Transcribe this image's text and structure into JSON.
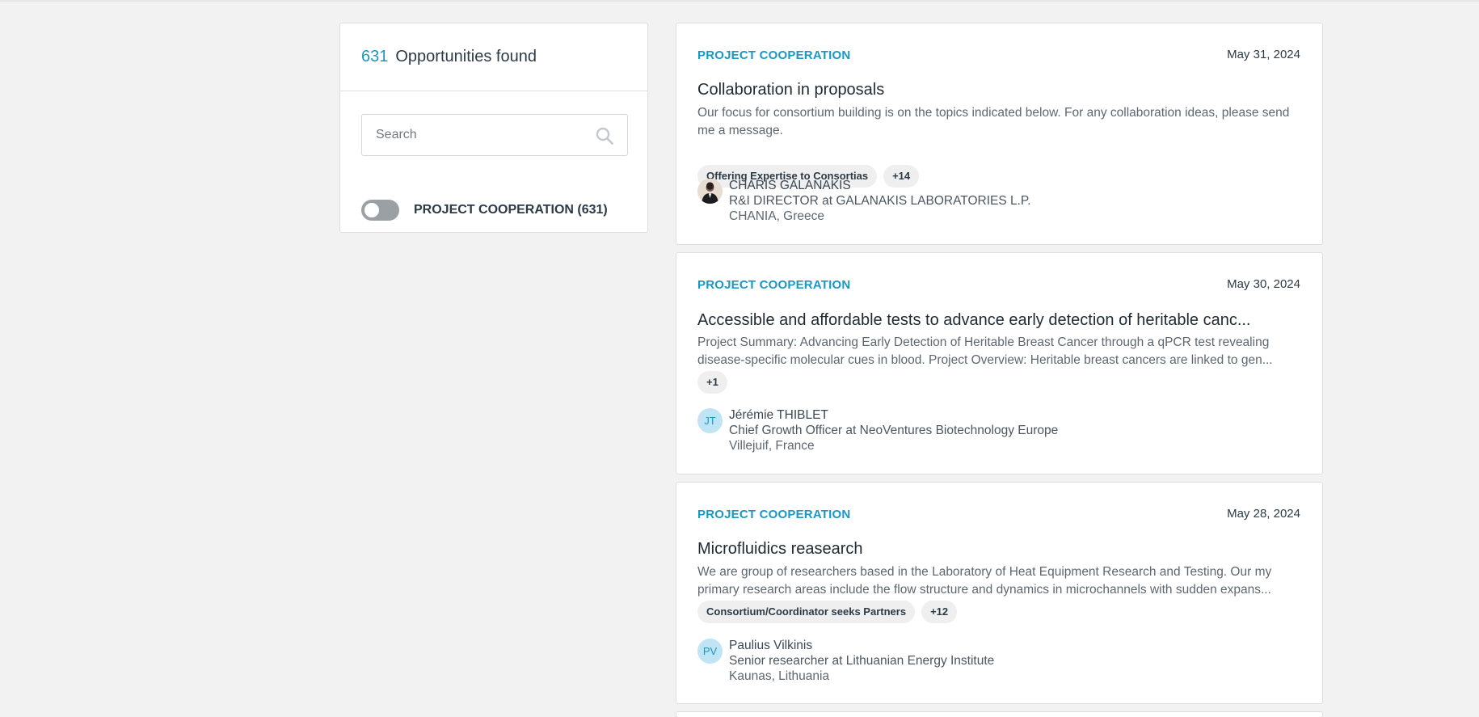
{
  "filter": {
    "count": "631",
    "count_label": "Opportunities found",
    "search_placeholder": "Search",
    "toggle_label": "PROJECT COOPERATION (631)"
  },
  "cards": [
    {
      "category": "PROJECT COOPERATION",
      "date": "May 31, 2024",
      "title": "Collaboration in proposals",
      "description": "Our focus for consortium building is on the topics indicated below. For any collaboration ideas, please send me a message.",
      "tags": [
        "Offering Expertise to Consortias",
        "+14"
      ],
      "person": {
        "avatar": "photo",
        "name": "CHARIS GALANAKIS",
        "role": "R&I DIRECTOR at GALANAKIS LABORATORIES L.P.",
        "location": "CHANIA, Greece"
      }
    },
    {
      "category": "PROJECT COOPERATION",
      "date": "May 30, 2024",
      "title": "Accessible and affordable tests to advance early detection of heritable canc...",
      "description": "Project Summary: Advancing Early Detection of Heritable Breast Cancer through a qPCR test revealing disease-specific molecular cues in blood. Project Overview: Heritable breast cancers are linked to gen...",
      "tags": [
        "+1"
      ],
      "person": {
        "avatar": "JT",
        "name": "Jérémie THIBLET",
        "role": "Chief Growth Officer at NeoVentures Biotechnology Europe",
        "location": "Villejuif, France"
      }
    },
    {
      "category": "PROJECT COOPERATION",
      "date": "May 28, 2024",
      "title": "Microfluidics reasearch",
      "description": "We are group of researchers based in the Laboratory of Heat Equipment Research and Testing. Our my primary research areas include the flow structure and dynamics in microchannels with sudden expans...",
      "tags": [
        "Consortium/Coordinator seeks Partners",
        "+12"
      ],
      "person": {
        "avatar": "PV",
        "name": "Paulius Vilkinis",
        "role": "Senior researcher at Lithuanian Energy Institute",
        "location": "Kaunas, Lithuania"
      }
    }
  ],
  "colors": {
    "accent": "#1997c6",
    "background": "#f2f2f2",
    "toggle_off": "#9aa0a4"
  }
}
